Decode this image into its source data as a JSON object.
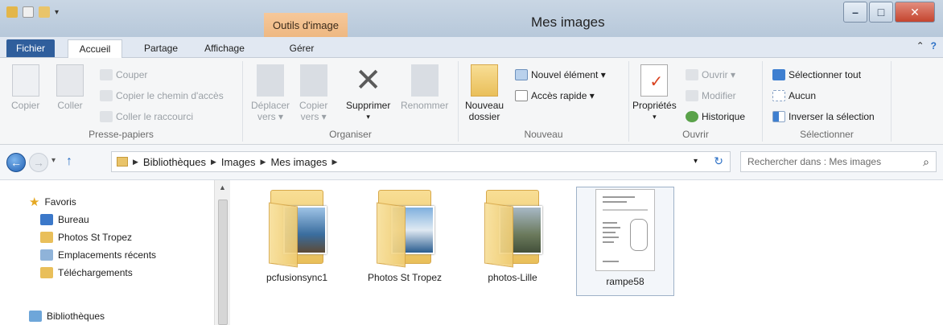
{
  "window": {
    "title": "Mes images",
    "context_tab_group": "Outils d'image"
  },
  "tabs": {
    "fichier": "Fichier",
    "accueil": "Accueil",
    "partage": "Partage",
    "affichage": "Affichage",
    "gerer": "Gérer"
  },
  "ribbon": {
    "presse_papiers": {
      "label": "Presse-papiers",
      "copier": "Copier",
      "coller": "Coller",
      "couper": "Couper",
      "copier_chemin": "Copier le chemin d'accès",
      "coller_raccourci": "Coller le raccourci"
    },
    "organiser": {
      "label": "Organiser",
      "deplacer_line1": "Déplacer",
      "deplacer_line2": "vers ▾",
      "copier_line1": "Copier",
      "copier_line2": "vers ▾",
      "supprimer": "Supprimer",
      "renommer": "Renommer"
    },
    "nouveau": {
      "label": "Nouveau",
      "nouveau_line1": "Nouveau",
      "nouveau_line2": "dossier",
      "nouvel_element": "Nouvel élément ▾",
      "acces_rapide": "Accès rapide ▾"
    },
    "ouvrir": {
      "label": "Ouvrir",
      "proprietes": "Propriétés",
      "ouvrir": "Ouvrir ▾",
      "modifier": "Modifier",
      "historique": "Historique"
    },
    "selectionner": {
      "label": "Sélectionner",
      "tout": "Sélectionner tout",
      "aucun": "Aucun",
      "inverser": "Inverser la sélection"
    }
  },
  "address": {
    "crumbs": [
      "Bibliothèques",
      "Images",
      "Mes images"
    ],
    "search_placeholder": "Rechercher dans : Mes images"
  },
  "nav": {
    "favoris": "Favoris",
    "bureau": "Bureau",
    "photos_st_tropez": "Photos St Tropez",
    "emplacements": "Emplacements récents",
    "telechargements": "Téléchargements",
    "bibliotheques": "Bibliothèques"
  },
  "items": [
    {
      "label": "pcfusionsync1",
      "type": "folder"
    },
    {
      "label": "Photos St Tropez",
      "type": "folder"
    },
    {
      "label": "photos-Lille",
      "type": "folder"
    },
    {
      "label": "rampe58",
      "type": "document"
    }
  ],
  "colors": {
    "accent": "#2f5e9c",
    "context_tab": "#eeb882",
    "close_button": "#c4442e",
    "folder": "#e9bf5a"
  }
}
